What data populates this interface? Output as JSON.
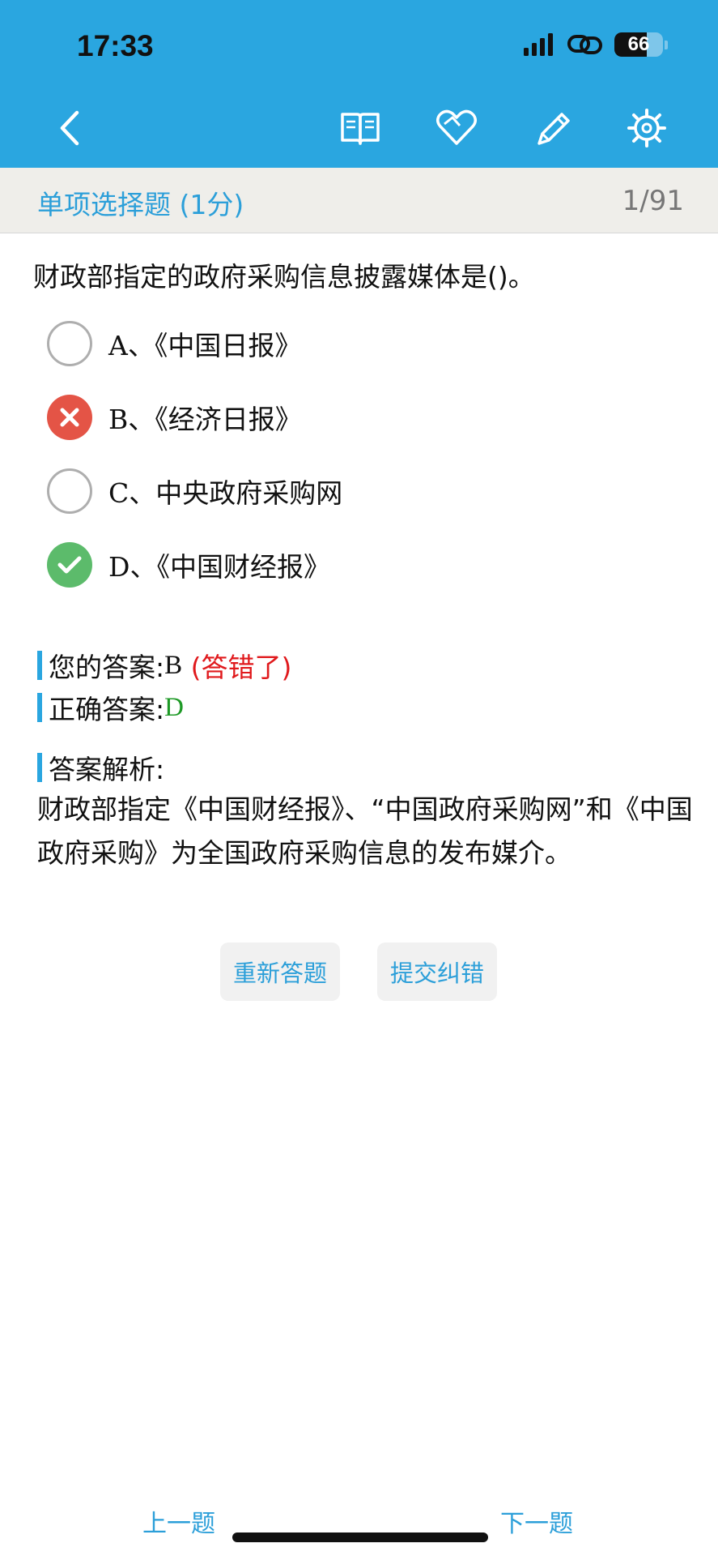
{
  "status_bar": {
    "time": "17:33",
    "battery": "66",
    "battery_level": 0.66
  },
  "nav": {
    "icons": [
      "back-icon",
      "book-icon",
      "heart-icon",
      "pencil-icon",
      "gear-icon"
    ]
  },
  "section": {
    "title": "单项选择题 (1分)",
    "progress": "1/91"
  },
  "question": {
    "text": "财政部指定的政府采购信息披露媒体是()。",
    "options": [
      {
        "letter": "A、",
        "text": "《中国日报》",
        "state": "unselected"
      },
      {
        "letter": "B、",
        "text": "《经济日报》",
        "state": "wrong"
      },
      {
        "letter": "C、",
        "text": "中央政府采购网",
        "state": "unselected"
      },
      {
        "letter": "D、",
        "text": "《中国财经报》",
        "state": "correct"
      }
    ]
  },
  "answer": {
    "your_label": "您的答案:",
    "your_value": "B",
    "wrong_note": "(答错了)",
    "correct_label": "正确答案:",
    "correct_value": "D",
    "analysis_label": "答案解析:",
    "analysis_text": "财政部指定《中国财经报》、“中国政府采购网”和《中国政府采购》为全国政府采购信息的发布媒介。"
  },
  "actions": {
    "retry": "重新答题",
    "report": "提交纠错"
  },
  "footer": {
    "prev": "上一题",
    "next": "下一题"
  },
  "colors": {
    "header": "#2aa6e0",
    "accent_text": "#2c9fd9",
    "wrong": "#e45446",
    "correct": "#5cbb6b",
    "wrong_text": "#e0191c",
    "correct_text": "#1f9a27"
  }
}
